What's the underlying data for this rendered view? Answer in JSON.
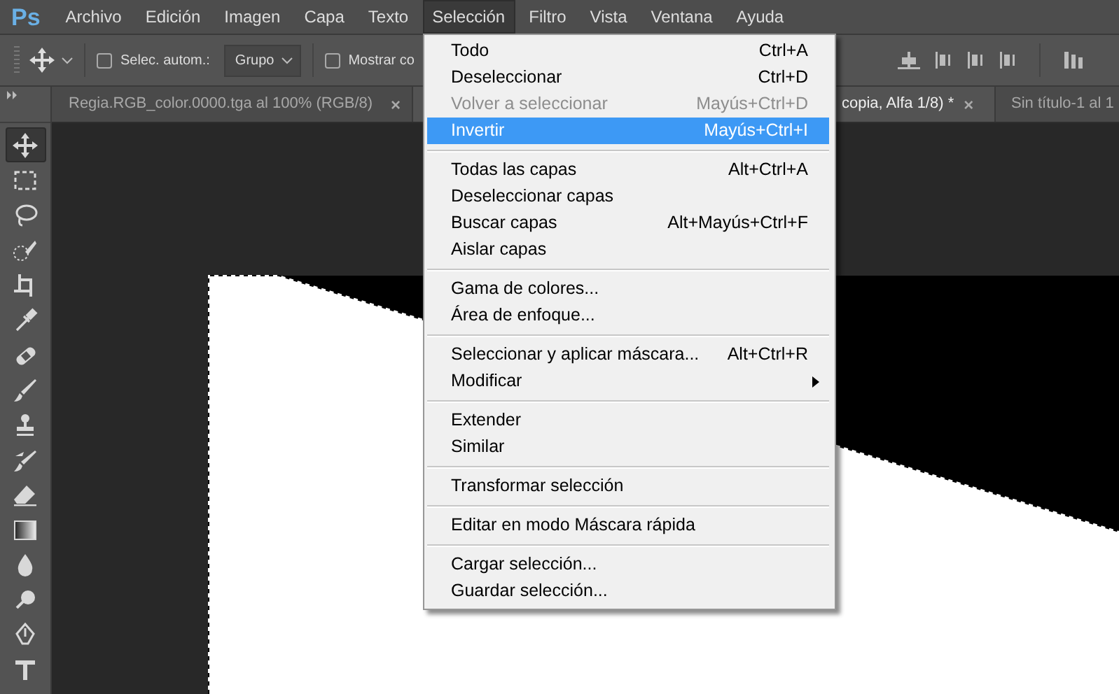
{
  "menu_bar": {
    "logo": "Ps",
    "items": [
      {
        "label": "Archivo",
        "selected": false
      },
      {
        "label": "Edición",
        "selected": false
      },
      {
        "label": "Imagen",
        "selected": false
      },
      {
        "label": "Capa",
        "selected": false
      },
      {
        "label": "Texto",
        "selected": false
      },
      {
        "label": "Selección",
        "selected": true
      },
      {
        "label": "Filtro",
        "selected": false
      },
      {
        "label": "Vista",
        "selected": false
      },
      {
        "label": "Ventana",
        "selected": false
      },
      {
        "label": "Ayuda",
        "selected": false
      }
    ]
  },
  "options_bar": {
    "auto_select": {
      "label": "Selec. autom.:",
      "checked": false
    },
    "group_dropdown": {
      "value": "Grupo"
    },
    "show_controls": {
      "label": "Mostrar co",
      "checked": false
    }
  },
  "tabs": [
    {
      "label": "Regia.RGB_color.0000.tga al 100% (RGB/8)",
      "close": "×",
      "selected": false
    },
    {
      "label": "copia, Alfa 1/8) *",
      "close": "×",
      "selected": true
    },
    {
      "label": "Sin título-1 al 1",
      "selected": false
    }
  ],
  "tools": [
    {
      "kind": "move",
      "selected": true
    },
    {
      "kind": "marquee",
      "selected": false
    },
    {
      "kind": "lasso",
      "selected": false
    },
    {
      "kind": "quick-select",
      "selected": false
    },
    {
      "kind": "crop",
      "selected": false
    },
    {
      "kind": "eyedropper",
      "selected": false
    },
    {
      "kind": "healing",
      "selected": false
    },
    {
      "kind": "brush",
      "selected": false
    },
    {
      "kind": "stamp",
      "selected": false
    },
    {
      "kind": "history-brush",
      "selected": false
    },
    {
      "kind": "eraser",
      "selected": false
    },
    {
      "kind": "gradient",
      "selected": false
    },
    {
      "kind": "blur",
      "selected": false
    },
    {
      "kind": "dodge",
      "selected": false
    },
    {
      "kind": "pen",
      "selected": false
    },
    {
      "kind": "type",
      "selected": false
    }
  ],
  "dropdown_menu": {
    "sections": [
      {
        "items": [
          {
            "label": "Todo",
            "shortcut": "Ctrl+A",
            "disabled": false,
            "selected": false
          },
          {
            "label": "Deseleccionar",
            "shortcut": "Ctrl+D",
            "disabled": false,
            "selected": false
          },
          {
            "label": "Volver a seleccionar",
            "shortcut": "Mayús+Ctrl+D",
            "disabled": true,
            "selected": false
          },
          {
            "label": "Invertir",
            "shortcut": "Mayús+Ctrl+I",
            "disabled": false,
            "selected": true
          }
        ]
      },
      {
        "items": [
          {
            "label": "Todas las capas",
            "shortcut": "Alt+Ctrl+A",
            "disabled": false,
            "selected": false
          },
          {
            "label": "Deseleccionar capas",
            "disabled": false,
            "selected": false
          },
          {
            "label": "Buscar capas",
            "shortcut": "Alt+Mayús+Ctrl+F",
            "disabled": false,
            "selected": false
          },
          {
            "label": "Aislar capas",
            "disabled": false,
            "selected": false
          }
        ]
      },
      {
        "items": [
          {
            "label": "Gama de colores...",
            "disabled": false,
            "selected": false
          },
          {
            "label": "Área de enfoque...",
            "disabled": false,
            "selected": false
          }
        ]
      },
      {
        "items": [
          {
            "label": "Seleccionar y aplicar máscara...",
            "shortcut": "Alt+Ctrl+R",
            "disabled": false,
            "selected": false
          },
          {
            "label": "Modificar",
            "submenu": true,
            "disabled": false,
            "selected": false
          }
        ]
      },
      {
        "items": [
          {
            "label": "Extender",
            "disabled": false,
            "selected": false
          },
          {
            "label": "Similar",
            "disabled": false,
            "selected": false
          }
        ]
      },
      {
        "items": [
          {
            "label": "Transformar selección",
            "disabled": false,
            "selected": false
          }
        ]
      },
      {
        "items": [
          {
            "label": "Editar en modo Máscara rápida",
            "disabled": false,
            "selected": false
          }
        ]
      },
      {
        "items": [
          {
            "label": "Cargar selección...",
            "disabled": false,
            "selected": false
          },
          {
            "label": "Guardar selección...",
            "disabled": false,
            "selected": false
          }
        ]
      }
    ]
  }
}
